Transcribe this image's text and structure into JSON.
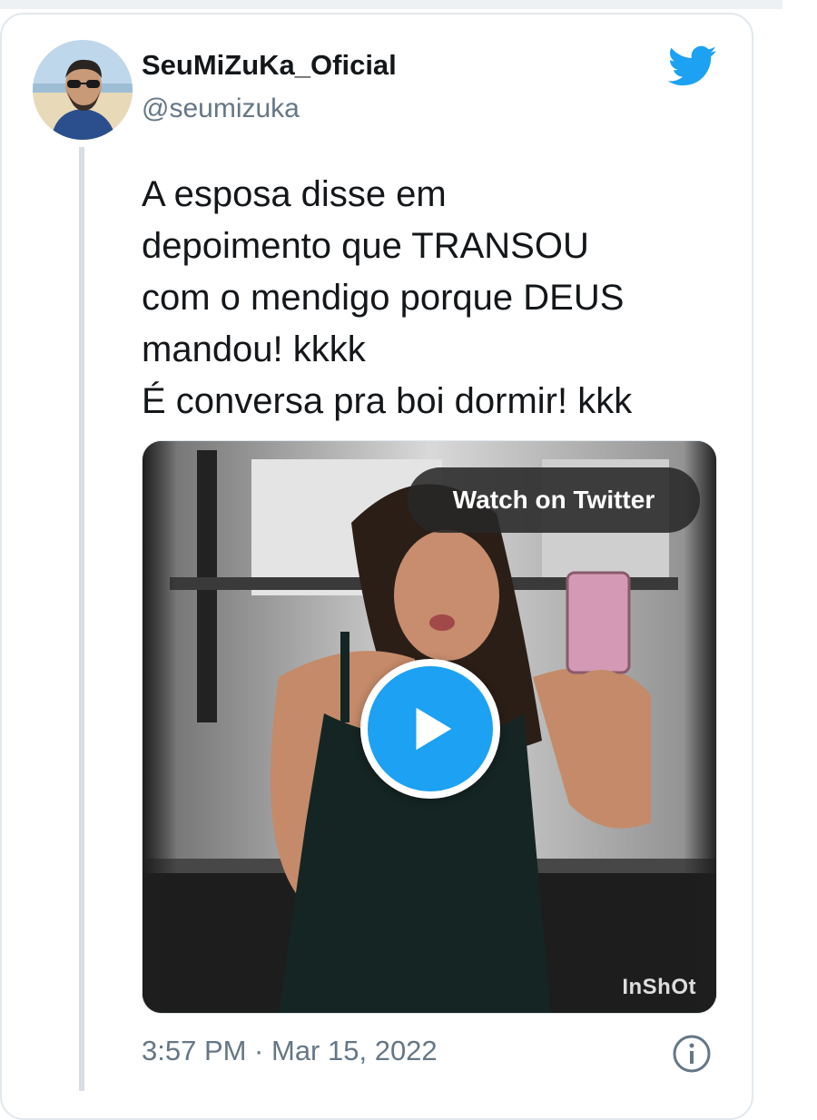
{
  "tweet": {
    "author": {
      "display_name": "SeuMiZuKa_Oficial",
      "handle": "@seumizuka"
    },
    "text_lines": [
      "A esposa disse em",
      "depoimento que TRANSOU",
      "com o mendigo porque DEUS",
      "mandou! kkkk",
      "É conversa pra boi dormir! kkk"
    ],
    "media": {
      "watch_label": "Watch on Twitter",
      "watermark": "InShOt"
    },
    "timestamp": "3:57 PM · Mar 15, 2022"
  },
  "icons": {
    "brand": "twitter-bird-icon",
    "play": "play-icon",
    "info": "info-icon"
  },
  "colors": {
    "twitter_blue": "#1da1f2",
    "text": "#14171a",
    "secondary": "#657786",
    "border": "#e1e8ed"
  }
}
